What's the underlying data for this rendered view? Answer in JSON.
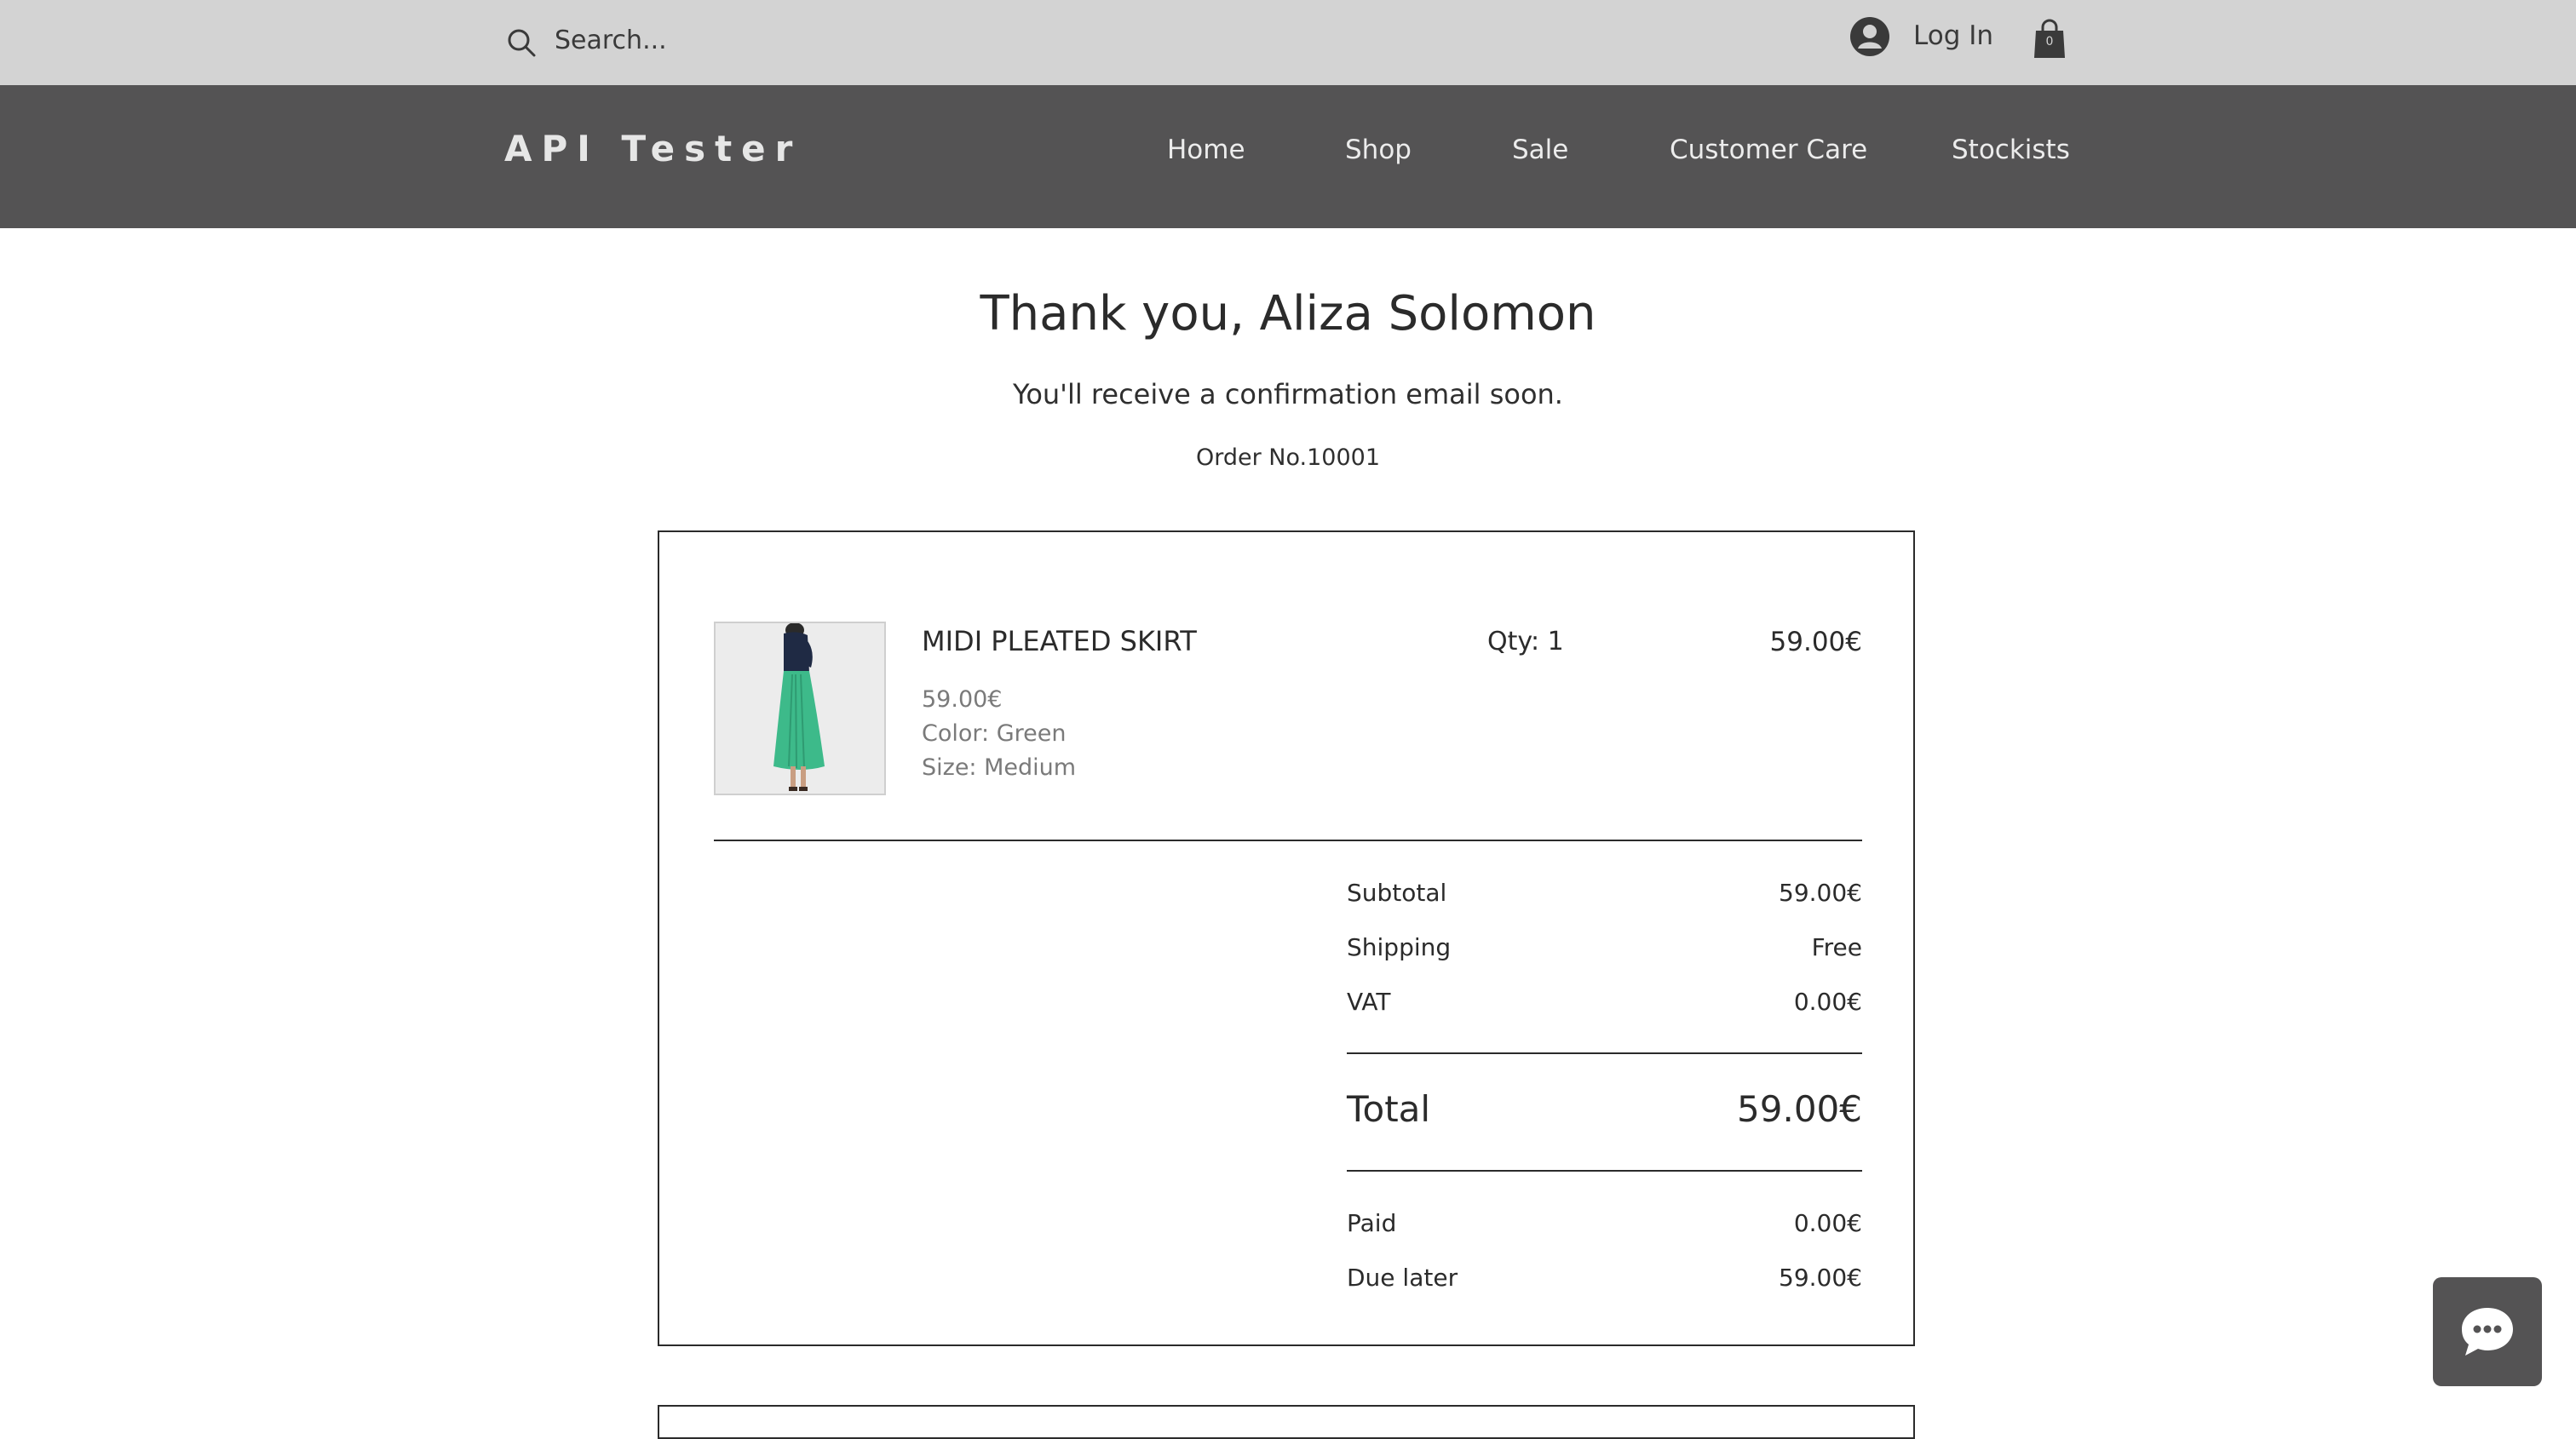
{
  "header": {
    "search_placeholder": "Search...",
    "login_label": "Log In",
    "cart_count": "0"
  },
  "nav": {
    "logo": "API Tester",
    "items": [
      {
        "label": "Home"
      },
      {
        "label": "Shop"
      },
      {
        "label": "Sale"
      },
      {
        "label": "Customer Care"
      },
      {
        "label": "Stockists"
      }
    ]
  },
  "confirmation": {
    "title": "Thank you, Aliza Solomon",
    "subtitle": "You'll receive a confirmation email soon.",
    "order_number": "Order No.10001"
  },
  "item": {
    "name": "MIDI PLEATED SKIRT",
    "price": "59.00€",
    "color": "Color: Green",
    "size": "Size: Medium",
    "qty": "Qty: 1",
    "line_total": "59.00€"
  },
  "summary": {
    "subtotal_label": "Subtotal",
    "subtotal_value": "59.00€",
    "shipping_label": "Shipping",
    "shipping_value": "Free",
    "vat_label": "VAT",
    "vat_value": "0.00€",
    "total_label": "Total",
    "total_value": "59.00€",
    "paid_label": "Paid",
    "paid_value": "0.00€",
    "due_label": "Due later",
    "due_value": "59.00€"
  },
  "colors": {
    "topbar": "#d3d3d3",
    "navbar": "#545354",
    "skirt": "#3dba8a",
    "top": "#1f2a44"
  }
}
